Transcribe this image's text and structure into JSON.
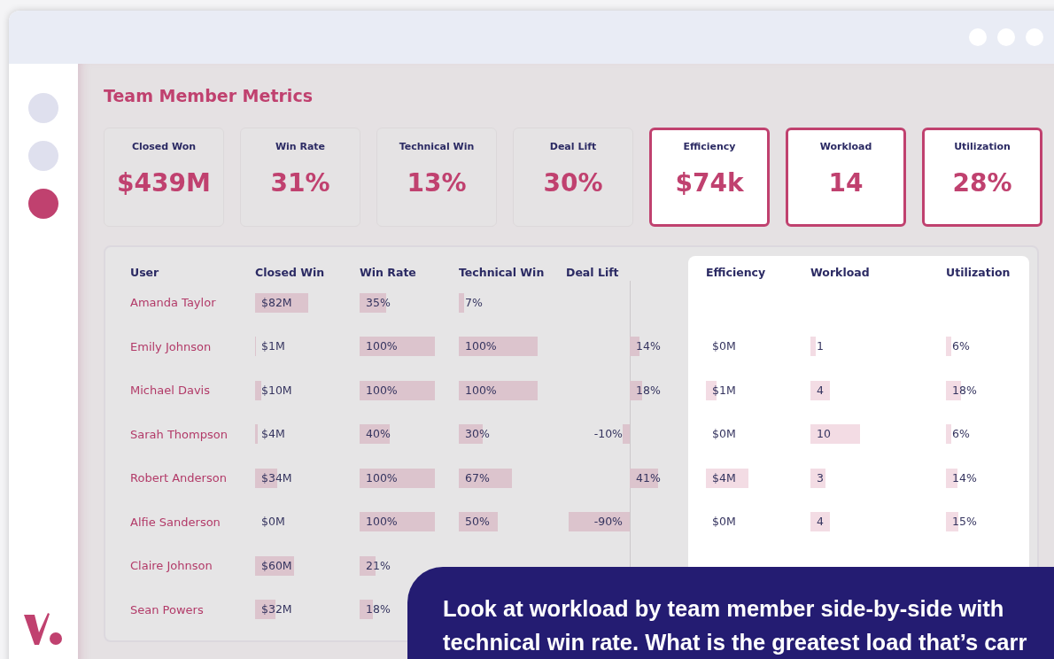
{
  "page_title": "Team Member Metrics",
  "sidebar": {
    "items": [
      {
        "selected": false
      },
      {
        "selected": false
      },
      {
        "selected": true
      }
    ]
  },
  "cards": [
    {
      "label": "Closed Won",
      "value": "$439M",
      "highlighted": false
    },
    {
      "label": "Win Rate",
      "value": "31%",
      "highlighted": false
    },
    {
      "label": "Technical Win",
      "value": "13%",
      "highlighted": false
    },
    {
      "label": "Deal Lift",
      "value": "30%",
      "highlighted": false
    },
    {
      "label": "Efficiency",
      "value": "$74k",
      "highlighted": true
    },
    {
      "label": "Workload",
      "value": "14",
      "highlighted": true
    },
    {
      "label": "Utilization",
      "value": "28%",
      "highlighted": true
    }
  ],
  "table": {
    "columns": [
      "User",
      "Closed Win",
      "Win Rate",
      "Technical Win",
      "Deal Lift",
      "Efficiency",
      "Workload",
      "Utilization"
    ],
    "rows": [
      {
        "user": "Amanda Taylor",
        "closed_win": "$82M",
        "win_rate": "35%",
        "technical_win": "7%"
      },
      {
        "user": "Emily Johnson",
        "closed_win": "$1M",
        "win_rate": "100%",
        "technical_win": "100%",
        "deal_lift": "14%",
        "efficiency": "$0M",
        "workload": "1",
        "utilization": "6%"
      },
      {
        "user": "Michael Davis",
        "closed_win": "$10M",
        "win_rate": "100%",
        "technical_win": "100%",
        "deal_lift": "18%",
        "efficiency": "$1M",
        "workload": "4",
        "utilization": "18%"
      },
      {
        "user": "Sarah Thompson",
        "closed_win": "$4M",
        "win_rate": "40%",
        "technical_win": "30%",
        "deal_lift": "-10%",
        "efficiency": "$0M",
        "workload": "10",
        "utilization": "6%"
      },
      {
        "user": "Robert Anderson",
        "closed_win": "$34M",
        "win_rate": "100%",
        "technical_win": "67%",
        "deal_lift": "41%",
        "efficiency": "$4M",
        "workload": "3",
        "utilization": "14%"
      },
      {
        "user": "Alfie Sanderson",
        "closed_win": "$0M",
        "win_rate": "100%",
        "technical_win": "50%",
        "deal_lift": "-90%",
        "efficiency": "$0M",
        "workload": "4",
        "utilization": "15%"
      },
      {
        "user": "Claire Johnson",
        "closed_win": "$60M",
        "win_rate": "21%"
      },
      {
        "user": "Sean Powers",
        "closed_win": "$32M",
        "win_rate": "18%"
      }
    ]
  },
  "callout": {
    "text": "Look at workload by team member side-by-side with technical win rate. What is the greatest load that’s carr"
  }
}
